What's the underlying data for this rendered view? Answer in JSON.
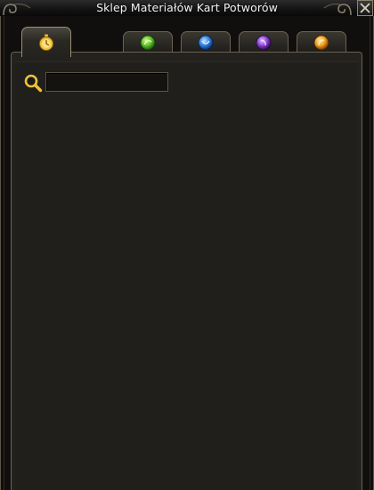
{
  "window": {
    "title": "Sklep Materiałów Kart Potworów"
  },
  "tabs": [
    {
      "icon": "stopwatch-icon",
      "color": "#e8b82a",
      "active": true
    },
    {
      "icon": "green-orb-icon",
      "color": "#5fc02a",
      "active": false
    },
    {
      "icon": "blue-orb-icon",
      "color": "#2f7fe0",
      "active": false
    },
    {
      "icon": "purple-orb-icon",
      "color": "#8a3fd0",
      "active": false
    },
    {
      "icon": "orange-orb-icon",
      "color": "#f0a020",
      "active": false
    }
  ],
  "search": {
    "value": "",
    "placeholder": ""
  },
  "colors": {
    "frame": "#6b6251",
    "panel": "#23221e",
    "accent_gold": "#e8b82a"
  }
}
